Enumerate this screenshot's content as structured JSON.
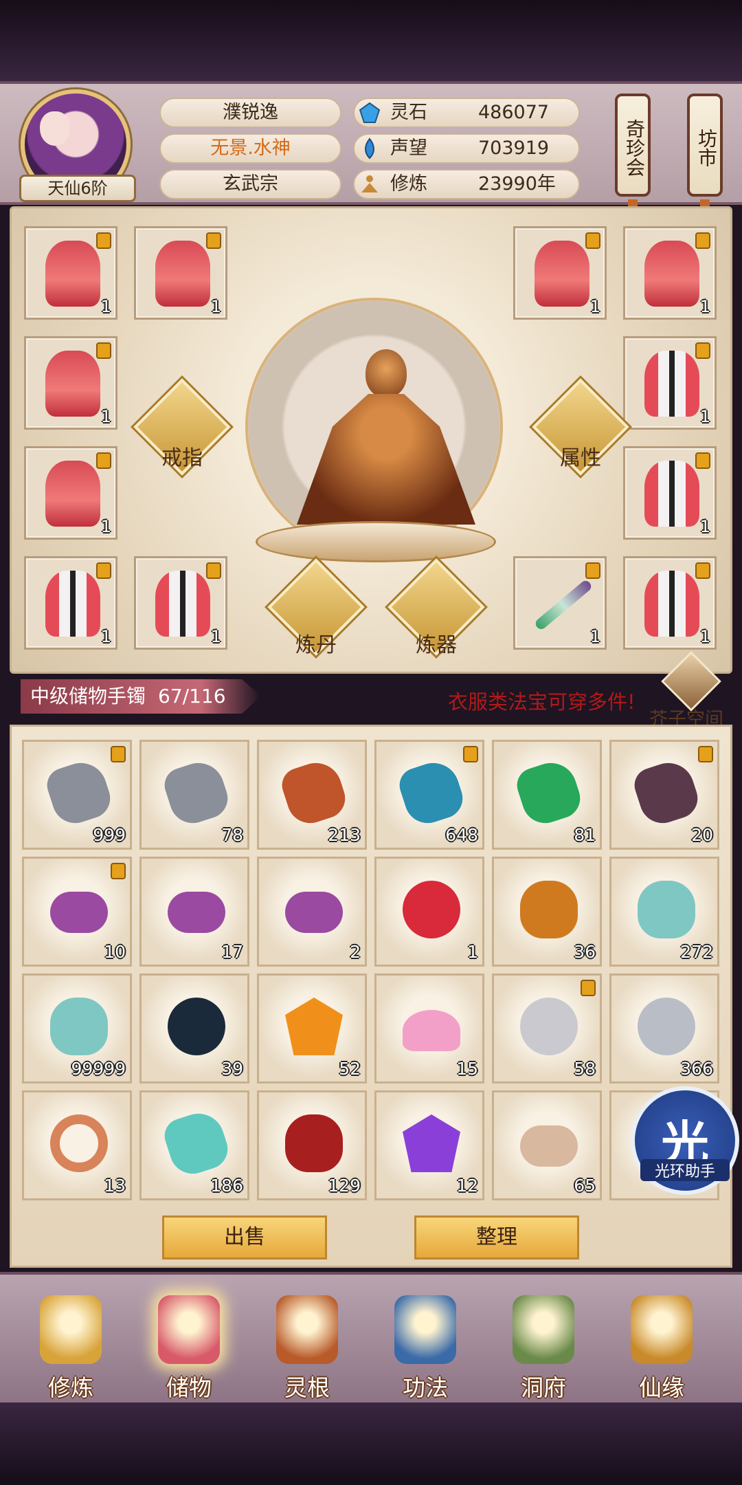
{
  "header": {
    "realm": "天仙6阶",
    "name": "濮锐逸",
    "title": "无景.水神",
    "sect": "玄武宗",
    "stats": [
      {
        "label": "灵石",
        "value": "486077",
        "icon": "spirit-stone-icon",
        "color": "#3aa0e6"
      },
      {
        "label": "声望",
        "value": "703919",
        "icon": "reputation-icon",
        "color": "#2e8ad6"
      },
      {
        "label": "修炼",
        "value": "23990年",
        "icon": "meditation-icon",
        "color": "#c88a38"
      }
    ],
    "lanterns": [
      "奇珍会",
      "坊市"
    ]
  },
  "equipment": {
    "actions": [
      "戒指",
      "属性",
      "炼丹",
      "炼器"
    ],
    "slots": [
      {
        "type": "robe-red",
        "qty": "1",
        "locked": true
      },
      {
        "type": "robe-red",
        "qty": "1",
        "locked": true
      },
      {
        "type": "robe-red",
        "qty": "1",
        "locked": true
      },
      {
        "type": "robe-red",
        "qty": "1",
        "locked": true
      },
      {
        "type": "robe-red",
        "qty": "1",
        "locked": true
      },
      {
        "type": "robe-white",
        "qty": "1",
        "locked": true
      },
      {
        "type": "robe-red",
        "qty": "1",
        "locked": true
      },
      {
        "type": "robe-white",
        "qty": "1",
        "locked": true
      },
      {
        "type": "robe-white",
        "qty": "1",
        "locked": true
      },
      {
        "type": "robe-white",
        "qty": "1",
        "locked": true
      },
      {
        "type": "sword",
        "qty": "1",
        "locked": true
      },
      {
        "type": "robe-white",
        "qty": "1",
        "locked": true
      }
    ]
  },
  "storage": {
    "name": "中级储物手镯",
    "capacity": "67/116",
    "hint": "衣服类法宝可穿多件!",
    "space_label": "芥子空间",
    "sell_label": "出售",
    "sort_label": "整理",
    "items": [
      {
        "icon": "silver-ore-icon",
        "qty": "999",
        "locked": true,
        "color": "#8a8f99",
        "shape": "rock"
      },
      {
        "icon": "silver-ore-icon",
        "qty": "78",
        "locked": false,
        "color": "#8a8f99",
        "shape": "rock"
      },
      {
        "icon": "fire-crystal-icon",
        "qty": "213",
        "locked": false,
        "color": "#c0542a",
        "shape": "rock"
      },
      {
        "icon": "blue-crystal-icon",
        "qty": "648",
        "locked": true,
        "color": "#2a8fb0",
        "shape": "rock"
      },
      {
        "icon": "green-crystal-icon",
        "qty": "81",
        "locked": false,
        "color": "#27a85a",
        "shape": "rock"
      },
      {
        "icon": "dark-crystal-icon",
        "qty": "20",
        "locked": true,
        "color": "#5a3a4a",
        "shape": "rock"
      },
      {
        "icon": "purple-scroll-icon",
        "qty": "10",
        "locked": true,
        "color": "#9a4aa0",
        "shape": "scroll"
      },
      {
        "icon": "purple-scroll-icon",
        "qty": "17",
        "locked": false,
        "color": "#9a4aa0",
        "shape": "scroll"
      },
      {
        "icon": "purple-scroll-icon",
        "qty": "2",
        "locked": false,
        "color": "#9a4aa0",
        "shape": "scroll"
      },
      {
        "icon": "red-pearl-icon",
        "qty": "1",
        "locked": false,
        "color": "#d82a3a",
        "shape": "round"
      },
      {
        "icon": "gourd-icon",
        "qty": "36",
        "locked": false,
        "color": "#d07a20",
        "shape": "gourd"
      },
      {
        "icon": "jade-vase-icon",
        "qty": "272",
        "locked": false,
        "color": "#7fc7c2",
        "shape": "gourd"
      },
      {
        "icon": "jade-vase-icon",
        "qty": "99999",
        "locked": false,
        "color": "#7fc7c2",
        "shape": "gourd"
      },
      {
        "icon": "star-chart-icon",
        "qty": "39",
        "locked": false,
        "color": "#1a2a3a",
        "shape": "round"
      },
      {
        "icon": "amber-gem-icon",
        "qty": "52",
        "locked": false,
        "color": "#f0901a",
        "shape": "gem"
      },
      {
        "icon": "lotus-icon",
        "qty": "15",
        "locked": false,
        "color": "#f2a0c8",
        "shape": "flower"
      },
      {
        "icon": "silver-orb-icon",
        "qty": "58",
        "locked": true,
        "color": "#c9c9cf",
        "shape": "round"
      },
      {
        "icon": "silver-orb-cracked-icon",
        "qty": "366",
        "locked": false,
        "color": "#b9bdc6",
        "shape": "round"
      },
      {
        "icon": "ring-icon",
        "qty": "13",
        "locked": false,
        "color": "#d8835a",
        "shape": "ring"
      },
      {
        "icon": "jade-cloud-icon",
        "qty": "186",
        "locked": false,
        "color": "#5fc9c0",
        "shape": "rock"
      },
      {
        "icon": "teapot-icon",
        "qty": "129",
        "locked": false,
        "color": "#a81f1f",
        "shape": "gourd"
      },
      {
        "icon": "amethyst-icon",
        "qty": "12",
        "locked": false,
        "color": "#8a40d8",
        "shape": "gem"
      },
      {
        "icon": "paper-scroll-icon",
        "qty": "65",
        "locked": false,
        "color": "#d9b8a0",
        "shape": "scroll"
      },
      {
        "icon": "hidden-item-icon",
        "qty": "",
        "locked": false,
        "color": "#bfb3a3",
        "shape": "round"
      }
    ]
  },
  "helper": {
    "glyph": "光",
    "label": "光环助手"
  },
  "nav": [
    {
      "label": "修炼",
      "icon": "cultivate-icon",
      "color": "#d8a43a",
      "active": false
    },
    {
      "label": "储物",
      "icon": "storage-bag-icon",
      "color": "#d85a6a",
      "active": true
    },
    {
      "label": "灵根",
      "icon": "spirit-root-icon",
      "color": "#b85a2a",
      "active": false
    },
    {
      "label": "功法",
      "icon": "technique-book-icon",
      "color": "#3a6aa8",
      "active": false
    },
    {
      "label": "洞府",
      "icon": "cave-house-icon",
      "color": "#6a8a4a",
      "active": false
    },
    {
      "label": "仙缘",
      "icon": "fortune-gourd-icon",
      "color": "#c88a2a",
      "active": false
    }
  ]
}
